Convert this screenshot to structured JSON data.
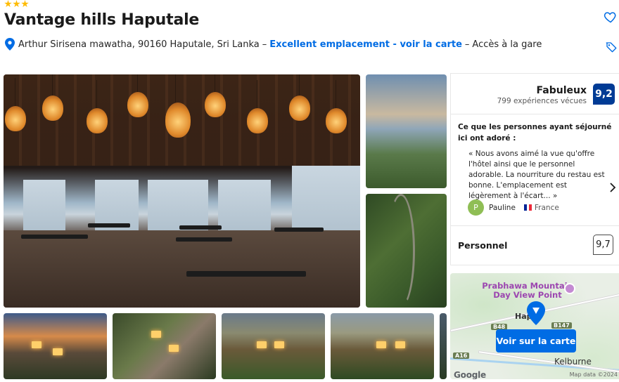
{
  "hotel": {
    "stars": 3,
    "name": "Vantage hills Haputale",
    "address": "Arthur Sirisena mawatha, 90160 Haputale, Sri Lanka",
    "dash1": "–",
    "location_link": "Excellent emplacement - voir la carte",
    "dash2": "–",
    "station": "Accès à la gare"
  },
  "rating": {
    "label": "Fabuleux",
    "reviews": "799 expériences vécues",
    "score": "9,2"
  },
  "highlight": {
    "heading": "Ce que les personnes ayant séjourné ici ont adoré :",
    "quote": "« Nous avons aimé la vue qu'offre l'hôtel ainsi que le personnel adorable. La nourriture du restau est bonne. L'emplacement est légèrement à l'écart... »",
    "author_initial": "P",
    "author": "Pauline",
    "country": "France"
  },
  "staff": {
    "label": "Personnel",
    "score": "9,7"
  },
  "map": {
    "poi": "Prabhawa Mountain Day View Point",
    "town": "Hap",
    "button": "Voir sur la carte",
    "place": "Kelburne",
    "shield1": "B48",
    "shield2": "B147",
    "shield3": "A16",
    "google": "Google",
    "copyright": "Map data ©2024"
  },
  "colors": {
    "brand": "#006ce4",
    "badge": "#003b95",
    "star": "#febb02"
  }
}
